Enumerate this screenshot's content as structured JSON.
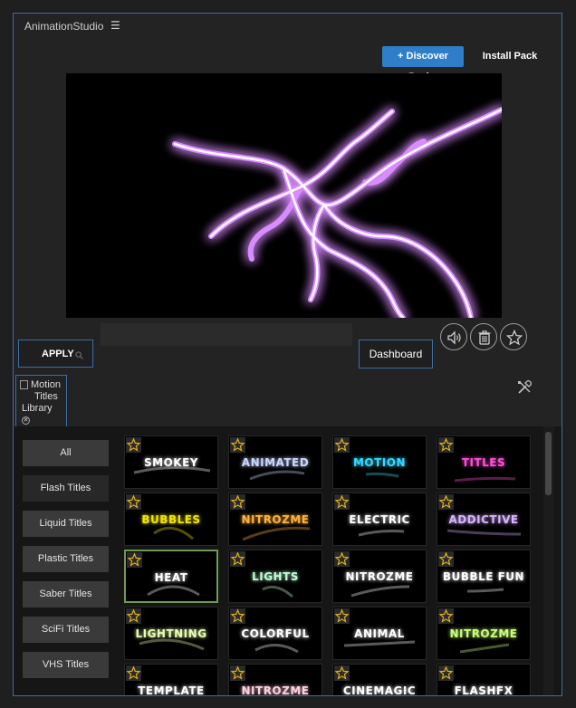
{
  "app": {
    "title": "AnimationStudio",
    "menu_icon": "hamburger-icon"
  },
  "toolbar": {
    "discover_label": "+ Discover Packs",
    "install_label": "Install Pack"
  },
  "preview": {
    "description_colors": {
      "glow": "#d98cff",
      "core": "#ffffff"
    }
  },
  "search": {
    "value": ""
  },
  "actions": {
    "apply_label": "APPLY",
    "dashboard_label": "Dashboard",
    "sound_icon": "speaker-icon",
    "delete_icon": "trash-icon",
    "favorite_icon": "star-icon"
  },
  "library_tab": {
    "line1": "Motion",
    "line2": "Titles",
    "line3": "Library",
    "close_icon": "close-icon"
  },
  "categories": [
    {
      "label": "All",
      "active": false
    },
    {
      "label": "Flash Titles",
      "active": true
    },
    {
      "label": "Liquid Titles",
      "active": false
    },
    {
      "label": "Plastic Titles",
      "active": false
    },
    {
      "label": "Saber Titles",
      "active": false
    },
    {
      "label": "SciFi Titles",
      "active": false
    },
    {
      "label": "VHS Titles",
      "active": false
    }
  ],
  "tiles": [
    {
      "text": "SMOKEY",
      "color": "#ffffff"
    },
    {
      "text": "ANIMATED",
      "color": "#c9d6ff"
    },
    {
      "text": "MOTION",
      "color": "#36d9ff"
    },
    {
      "text": "TITLES",
      "color": "#ff4fd8"
    },
    {
      "text": "BUBBLES",
      "color": "#f2e600"
    },
    {
      "text": "NITROZME",
      "color": "#ffb13b"
    },
    {
      "text": "ELECTRIC",
      "color": "#ffffff"
    },
    {
      "text": "ADDICTIVE",
      "color": "#d8b3ff"
    },
    {
      "text": "HEAT",
      "color": "#ffffff",
      "selected": true
    },
    {
      "text": "LIGHTS",
      "color": "#bfffd6"
    },
    {
      "text": "NITROZME",
      "color": "#ffffff"
    },
    {
      "text": "BUBBLE FUN",
      "color": "#ffffff"
    },
    {
      "text": "LIGHTNING",
      "color": "#e8ffb0"
    },
    {
      "text": "COLORFUL",
      "color": "#ffffff"
    },
    {
      "text": "ANIMAL",
      "color": "#ffffff"
    },
    {
      "text": "NITROZME",
      "color": "#c8ff7a"
    },
    {
      "text": "TEMPLATE",
      "color": "#ffffff"
    },
    {
      "text": "NITROZME",
      "color": "#ffd0e0"
    },
    {
      "text": "CINEMAGIC",
      "color": "#ffffff"
    },
    {
      "text": "FLASHFX",
      "color": "#ffffff"
    }
  ],
  "colors": {
    "accent": "#2f7ec9",
    "border": "#3a6ea5",
    "selected": "#6e9b53",
    "star": "#e0b020"
  }
}
